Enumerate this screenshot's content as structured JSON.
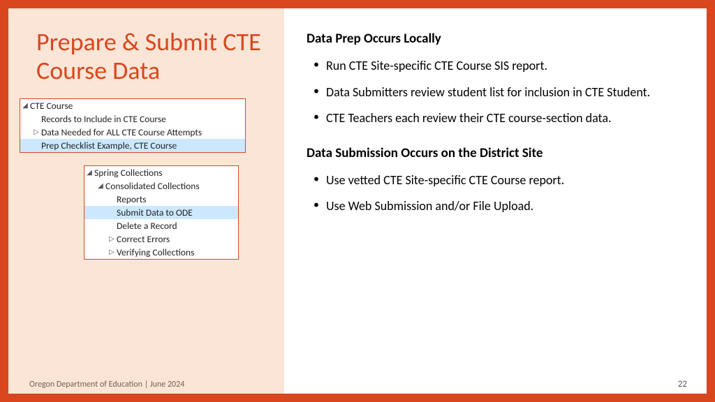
{
  "title": "Prepare & Submit CTE Course Data",
  "tree1": {
    "r0": {
      "arrow": "◢",
      "label": "CTE Course"
    },
    "r1": {
      "arrow": "",
      "label": "Records to Include in CTE Course"
    },
    "r2": {
      "arrow": "▷",
      "label": "Data Needed for ALL CTE Course Attempts"
    },
    "r3": {
      "arrow": "",
      "label": "Prep Checklist Example, CTE Course"
    }
  },
  "tree2": {
    "r0": {
      "arrow": "◢",
      "label": "Spring Collections"
    },
    "r1": {
      "arrow": "◢",
      "label": "Consolidated Collections"
    },
    "r2": {
      "arrow": "",
      "label": "Reports"
    },
    "r3": {
      "arrow": "",
      "label": "Submit Data to ODE"
    },
    "r4": {
      "arrow": "",
      "label": "Delete a Record"
    },
    "r5": {
      "arrow": "▷",
      "label": "Correct Errors"
    },
    "r6": {
      "arrow": "▷",
      "label": "Verifying Collections"
    }
  },
  "right": {
    "h1": "Data Prep Occurs Locally",
    "b1": "Run CTE Site-specific CTE Course SIS report.",
    "b2": "Data Submitters review student list for inclusion in CTE Student.",
    "b3": "CTE Teachers each review their CTE course-section data.",
    "h2": "Data Submission Occurs on the District Site",
    "b4": "Use vetted CTE Site-specific CTE Course report.",
    "b5": "Use Web Submission and/or File Upload."
  },
  "footer": "Oregon Department of Education | June 2024",
  "page": "22"
}
